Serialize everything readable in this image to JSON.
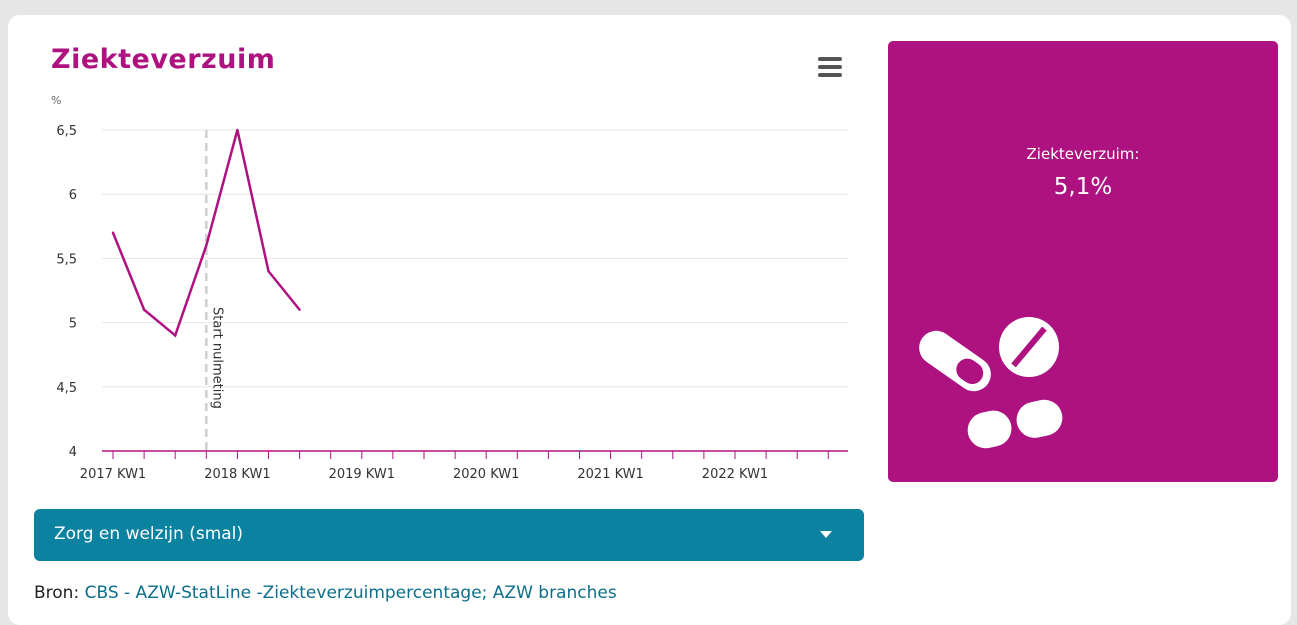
{
  "header": {
    "title": "Ziekteverzuim"
  },
  "menu": {
    "icon": "hamburger-menu-icon"
  },
  "chart_data": {
    "type": "line",
    "unit_label": "%",
    "ylim": [
      4,
      6.5
    ],
    "yticks": [
      4,
      4.5,
      5,
      5.5,
      6,
      6.5
    ],
    "ytick_labels": [
      "4",
      "4,5",
      "5",
      "5,5",
      "6",
      "6,5"
    ],
    "xtick_labels": [
      "2017 KW1",
      "2018 KW1",
      "2019 KW1",
      "2020 KW1",
      "2021 KW1",
      "2022 KW1"
    ],
    "x_range_quarters": [
      0,
      23
    ],
    "grid": true,
    "series": [
      {
        "color": "#ae1280",
        "x": [
          "2017 KW1",
          "2017 KW2",
          "2017 KW3",
          "2017 KW4",
          "2018 KW1",
          "2018 KW2",
          "2018 KW3"
        ],
        "values": [
          5.7,
          5.1,
          4.9,
          5.6,
          6.5,
          5.4,
          5.1
        ]
      }
    ],
    "annotations": [
      {
        "type": "vertical-line",
        "at": "2017 KW4",
        "label": "Start nulmeting"
      }
    ]
  },
  "stat_panel": {
    "label": "Ziekteverzuim:",
    "value": "5,1%",
    "icon": "pills-icon",
    "background": "#ae1280"
  },
  "filter": {
    "selected": "Zorg en welzijn (smal)"
  },
  "source": {
    "prefix": "Bron:",
    "link_text": "CBS - AZW-StatLine -Ziekteverzuimpercentage; AZW branches"
  },
  "colors": {
    "accent": "#ae1280",
    "dropdown": "#0b82a0",
    "link": "#0b6e8a"
  }
}
